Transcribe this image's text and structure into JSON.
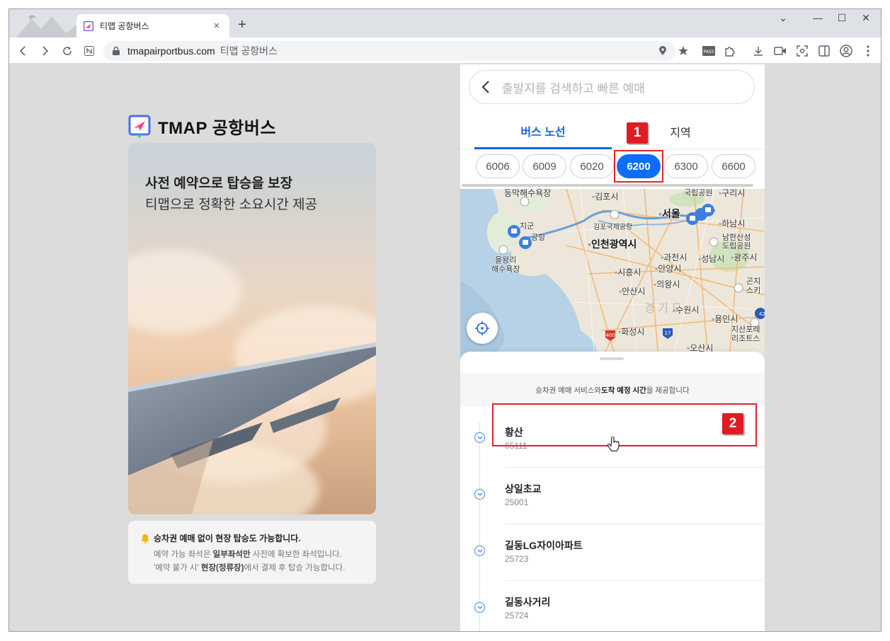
{
  "browser": {
    "tab": {
      "title": "티맵 공항버스",
      "close": "×"
    },
    "new_tab": "+",
    "window_controls": {
      "minimize": "—",
      "maximize": "☐",
      "close": "✕",
      "menu": "⌄"
    },
    "address": {
      "url": "tmapairportbus.com",
      "page_title": "티맵 공항버스"
    }
  },
  "left": {
    "brand": "TMAP 공항버스",
    "hero": {
      "headline": "사전 예약으로 탑승을 보장",
      "subline": "티맵으로 정확한 소요시간 제공"
    },
    "notice": {
      "title": "승차권 예매 없이 현장 탑승도 가능합니다.",
      "line1_pre": "예약 가능 좌석은 ",
      "line1_bold": "일부좌석만",
      "line1_post": " 사전에 확보한 좌석입니다.",
      "line2_pre": "'예약 불가 시' ",
      "line2_bold": "현장(정류장)",
      "line2_post": "에서 결제 후 탑승 가능합니다."
    }
  },
  "panel": {
    "search_placeholder": "출발지를 검색하고 빠른 예매",
    "tabs": [
      "버스 노선",
      "지역"
    ],
    "routes": [
      "6006",
      "6009",
      "6020",
      "6200",
      "6300",
      "6600"
    ],
    "selected_route": "6200",
    "map_labels": {
      "gimpo": "김포시",
      "gimpo_airport": "김포국제공항",
      "incheon": "인천광역시",
      "seoul": "서울",
      "hanam": "하남시",
      "gwacheon": "과천시",
      "seongnam": "성남시",
      "gwangju": "광주시",
      "siheung": "시흥시",
      "anyang": "안양시",
      "uiwang": "의왕시",
      "ansan": "안산시",
      "suwon": "수원시",
      "yongin": "용인시",
      "hwaseong": "화성시",
      "osan": "오산시",
      "gyeonggi": "경 기 도",
      "eulwangri": "을왕리\n해수욕장",
      "dongmak": "동막해수욕장",
      "namhansan": "남한산성\n도립공원",
      "jisan": "지산포레\n리조트스",
      "gukrip": "국립공원",
      "guri": "구리시",
      "gonji": "곤지\n스키",
      "jigun": "지군",
      "gonghang": "공항",
      "road_400": "400",
      "road_17": "17",
      "road_42": "42"
    },
    "info_pre": "승차권 예매 서비스와 ",
    "info_bold": "도착 예정 시간",
    "info_post": "을 제공합니다",
    "stops": [
      {
        "name": "황산",
        "code": "65111"
      },
      {
        "name": "상일초교",
        "code": "25001"
      },
      {
        "name": "길동LG자이아파트",
        "code": "25723"
      },
      {
        "name": "길동사거리",
        "code": "25724"
      }
    ]
  },
  "annotations": {
    "badge1": "1",
    "badge2": "2"
  },
  "colors": {
    "accent": "#1463e6",
    "chip_active": "#0d6efd",
    "annotation": "#e8212a"
  }
}
